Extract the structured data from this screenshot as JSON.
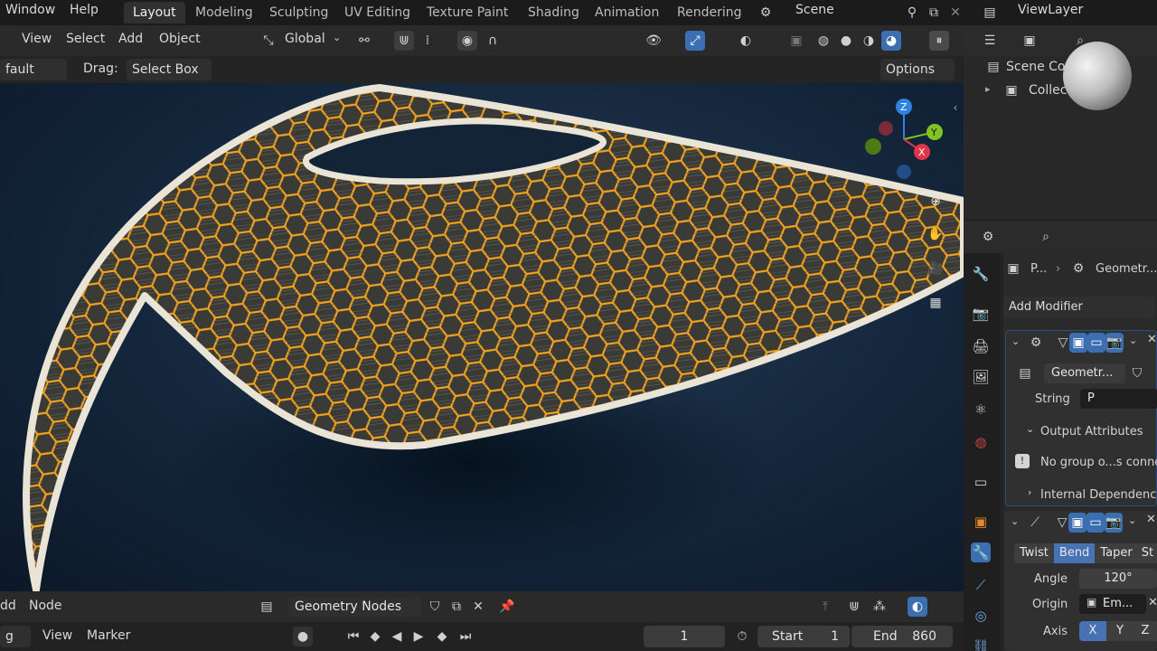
{
  "topbar": {
    "menus": [
      "Window",
      "Help"
    ],
    "workspaces": [
      "Layout",
      "Modeling",
      "Sculpting",
      "UV Editing",
      "Texture Paint",
      "Shading",
      "Animation",
      "Rendering"
    ],
    "active_workspace": "Layout",
    "scene": "Scene",
    "view_layer": "ViewLayer"
  },
  "viewport_header": {
    "menus": [
      "View",
      "Select",
      "Add",
      "Object"
    ],
    "orientation": "Global",
    "mode_partial": "fault",
    "drag_label": "Drag:",
    "drag_value": "Select Box",
    "options_label": "Options"
  },
  "outliner": {
    "scene_collection": "Scene Co",
    "collection": "Collect"
  },
  "properties": {
    "breadcrumb_obj": "P...",
    "breadcrumb_mod": "Geometr...",
    "add_modifier": "Add Modifier",
    "geo_node_group": "Geometr...",
    "string_label": "String",
    "string_value": "P",
    "output_attributes": "Output Attributes",
    "warning": "No group o...s conne",
    "internal_deps": "Internal Dependencie",
    "deform_tabs": [
      "Twist",
      "Bend",
      "Taper",
      "St"
    ],
    "active_deform": "Bend",
    "angle_label": "Angle",
    "angle_value": "120°",
    "origin_label": "Origin",
    "origin_value": "Em...",
    "axis_label": "Axis",
    "axes": [
      "X",
      "Y",
      "Z"
    ],
    "active_axis": "X"
  },
  "node_editor": {
    "menus": [
      "dd",
      "Node"
    ],
    "tree_name": "Geometry Nodes"
  },
  "timeline": {
    "mode_partial": "g",
    "menus": [
      "View",
      "Marker"
    ],
    "current_frame": "1",
    "start_label": "Start",
    "start_value": "1",
    "end_label": "End",
    "end_value": "860"
  },
  "colors": {
    "accent": "#4772b3",
    "mesh_orange": "#f3a21e",
    "gizmo_x": "#e0344b",
    "gizmo_y": "#7fc421",
    "gizmo_z": "#2f83e0"
  }
}
